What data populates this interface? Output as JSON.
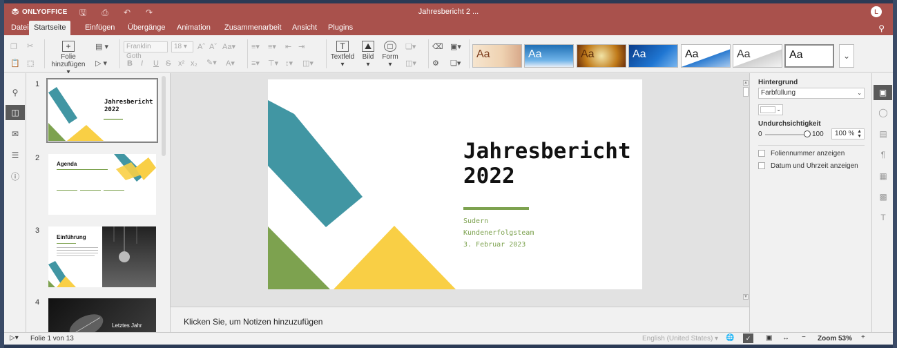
{
  "app": {
    "brand": "ONLYOFFICE",
    "title": "Jahresbericht 2 ...",
    "avatar_letter": "L"
  },
  "menu": {
    "tabs": [
      "Datei",
      "Startseite",
      "Einfügen",
      "Übergänge",
      "Animation",
      "Zusammenarbeit",
      "Ansicht",
      "Plugins"
    ],
    "active": "Startseite"
  },
  "toolbar": {
    "add_slide_label_1": "Folie",
    "add_slide_label_2": "hinzufügen",
    "font_name": "Franklin Goth",
    "font_size": "18",
    "textbox_label": "Textfeld",
    "image_label": "Bild",
    "shape_label": "Form",
    "theme_preview": "Aa"
  },
  "thumbnails": [
    {
      "num": "1",
      "title": "Jahresbericht 2022",
      "selected": true
    },
    {
      "num": "2",
      "title": "Agenda"
    },
    {
      "num": "3",
      "title": "Einführung"
    },
    {
      "num": "4",
      "title": "Letztes Jahr"
    }
  ],
  "slide": {
    "title_line1": "Jahresbericht",
    "title_line2": "2022",
    "sub1": "Sudern",
    "sub2": "Kundenerfolgsteam",
    "sub3": "3. Februar 2023",
    "colors": {
      "teal": "#4196a3",
      "green": "#7da24f",
      "yellow": "#f9cf45"
    }
  },
  "notes": {
    "placeholder": "Klicken Sie, um Notizen hinzuzufügen"
  },
  "settings": {
    "background_label": "Hintergrund",
    "fill_type": "Farbfüllung",
    "opacity_label": "Undurchsichtigkeit",
    "opacity_min": "0",
    "opacity_max": "100",
    "opacity_value": "100 %",
    "opacity_percent": 100,
    "show_slide_number": "Foliennummer anzeigen",
    "show_date_time": "Datum und Uhrzeit anzeigen"
  },
  "status": {
    "slide_info": "Folie 1 von 13",
    "language": "English (United States)",
    "zoom": "Zoom 53%"
  },
  "colors": {
    "header": "#a9514c"
  }
}
